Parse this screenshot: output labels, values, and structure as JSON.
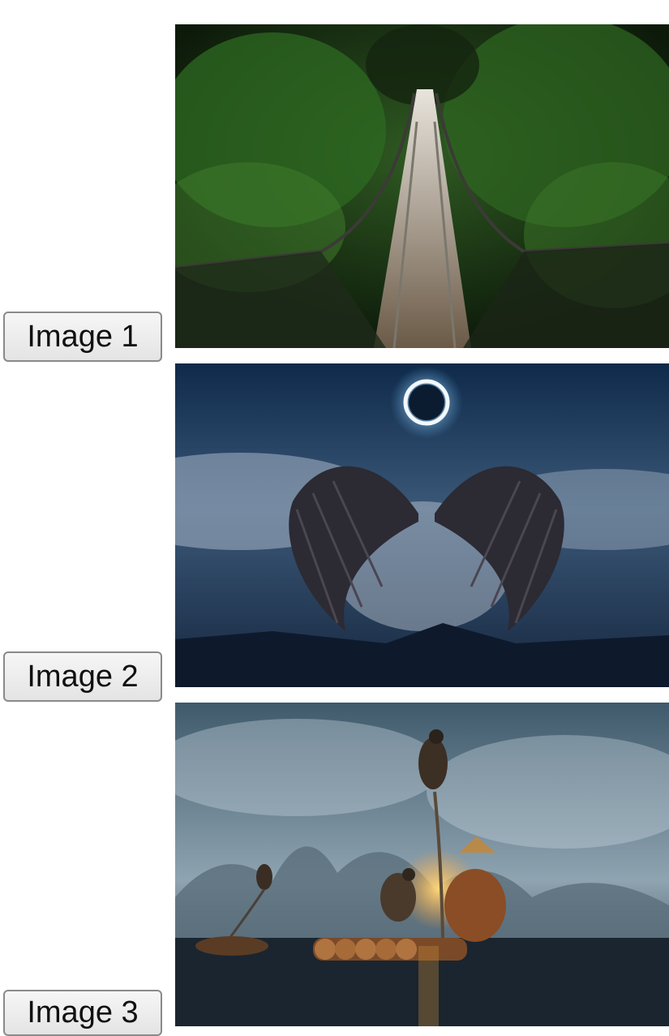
{
  "buttons": [
    {
      "label": "Image 1"
    },
    {
      "label": "Image 2"
    },
    {
      "label": "Image 3"
    }
  ],
  "images": [
    {
      "subject": "suspension bridge through forest",
      "icon": "forest-bridge-photo"
    },
    {
      "subject": "dark wings under eclipse ring in cloudy sky",
      "icon": "wings-eclipse-photo"
    },
    {
      "subject": "cormorant fisherman on bamboo raft at dusk",
      "icon": "cormorant-raft-photo"
    }
  ],
  "colors": {
    "button_bg": "#ececec",
    "button_border": "#8a8a8a",
    "page_bg": "#ffffff"
  }
}
